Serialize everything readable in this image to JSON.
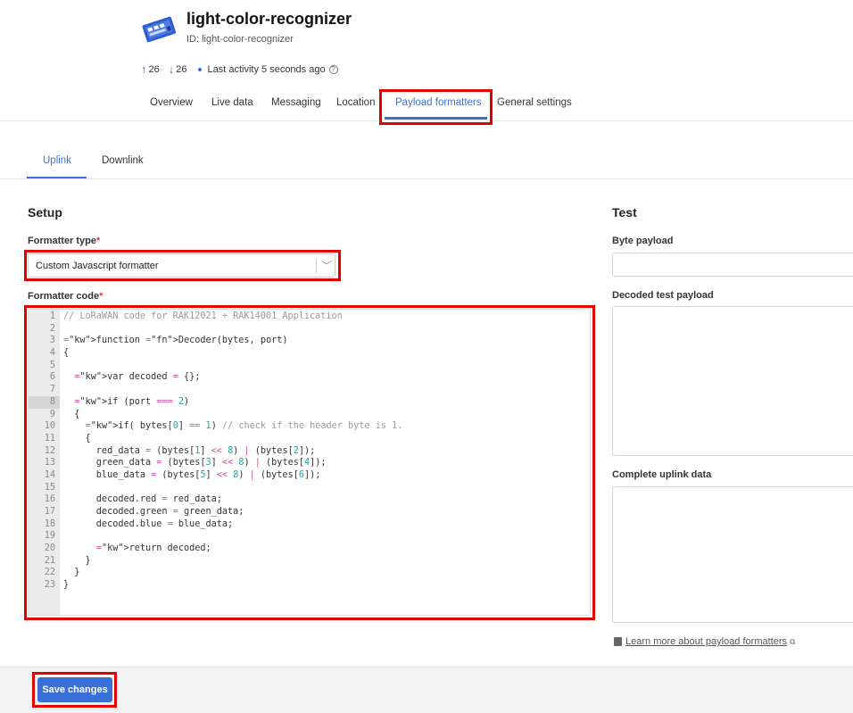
{
  "device": {
    "title": "light-color-recognizer",
    "id_text": "ID: light-color-recognizer",
    "icon": "lorawan-device-icon",
    "uplink_count": "26",
    "downlink_count": "26",
    "activity": "Last activity 5 seconds ago"
  },
  "main_tabs": [
    "Overview",
    "Live data",
    "Messaging",
    "Location",
    "Payload formatters",
    "General settings"
  ],
  "active_main_tab": "Payload formatters",
  "sub_tabs": [
    "Uplink",
    "Downlink"
  ],
  "active_sub_tab": "Uplink",
  "setup": {
    "title": "Setup",
    "formatter_type_label": "Formatter type",
    "formatter_type_value": "Custom Javascript formatter",
    "formatter_code_label": "Formatter code",
    "required_mark": "*"
  },
  "code_lines": [
    "// LoRaWAN code for RAK12021 + RAK14001 Application",
    "",
    "function Decoder(bytes, port)",
    "{",
    "",
    "  var decoded = {};",
    "",
    "  if (port === 2)",
    "  {",
    "    if( bytes[0] == 1) // check if the header byte is 1.",
    "    {",
    "      red_data = (bytes[1] << 8) | (bytes[2]);",
    "      green_data = (bytes[3] << 8) | (bytes[4]);",
    "      blue_data = (bytes[5] << 8) | (bytes[6]);",
    "",
    "      decoded.red = red_data;",
    "      decoded.green = green_data;",
    "      decoded.blue = blue_data;",
    "",
    "      return decoded;",
    "    }",
    "  }",
    "}"
  ],
  "test": {
    "title": "Test",
    "byte_payload_label": "Byte payload",
    "decoded_label": "Decoded test payload",
    "complete_label": "Complete uplink data",
    "learn_more": "Learn more about payload formatters"
  },
  "footer": {
    "save_label": "Save changes"
  },
  "colors": {
    "accent": "#3b6fd8",
    "highlight": "#e00000"
  }
}
